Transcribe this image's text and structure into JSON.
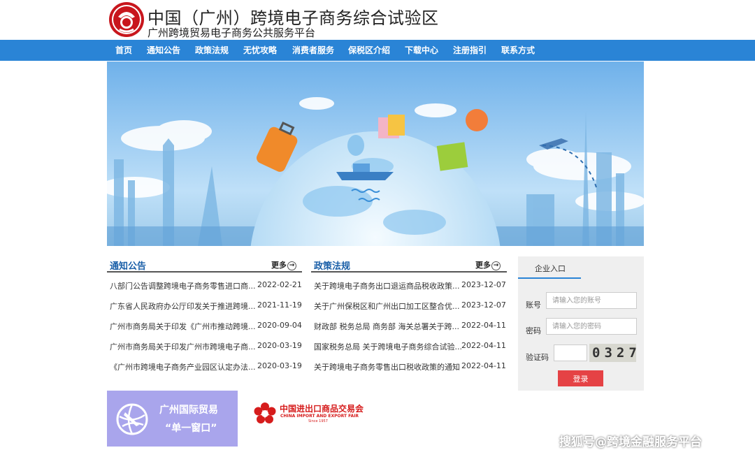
{
  "header": {
    "title": "中国（广州）跨境电子商务综合试验区",
    "subtitle": "广州跨境贸易电子商务公共服务平台"
  },
  "nav": {
    "items": [
      "首页",
      "通知公告",
      "政策法规",
      "无忧攻略",
      "消费者服务",
      "保税区介绍",
      "下载中心",
      "注册指引",
      "联系方式"
    ]
  },
  "notices": {
    "title": "通知公告",
    "more": "更多",
    "items": [
      {
        "title": "八部门公告调整跨境电子商务零售进口商...",
        "date": "2022-02-21"
      },
      {
        "title": "广东省人民政府办公厅印发关于推进跨境...",
        "date": "2021-11-19"
      },
      {
        "title": "广州市商务局关于印发《广州市推动跨境...",
        "date": "2020-09-04"
      },
      {
        "title": "广州市商务局关于印发广州市跨境电子商...",
        "date": "2020-03-19"
      },
      {
        "title": "《广州市跨境电子商务产业园区认定办法...",
        "date": "2020-03-19"
      }
    ]
  },
  "policies": {
    "title": "政策法规",
    "more": "更多",
    "items": [
      {
        "title": "关于跨境电子商务出口退运商品税收政策...",
        "date": "2023-12-07"
      },
      {
        "title": "关于广州保税区和广州出口加工区整合优...",
        "date": "2023-12-07"
      },
      {
        "title": "财政部 税务总局 商务部 海关总署关于跨...",
        "date": "2022-04-11"
      },
      {
        "title": "国家税务总局 关于跨境电子商务综合试验...",
        "date": "2022-04-11"
      },
      {
        "title": "关于跨境电子商务零售出口税收政策的通知",
        "date": "2022-04-11"
      }
    ]
  },
  "login": {
    "tab": "企业入口",
    "account_label": "账号",
    "account_placeholder": "请输入您的账号",
    "password_label": "密码",
    "password_placeholder": "请输入您的密码",
    "captcha_label": "验证码",
    "captcha_value": "0327",
    "submit": "登录"
  },
  "promo": {
    "single_window_line1": "广州国际贸易",
    "single_window_line2": "“单一窗口”",
    "fair_cn": "中国进出口商品交易会",
    "fair_en": "CHINA IMPORT AND EXPORT FAIR",
    "fair_since": "Since 1957"
  },
  "watermark": "搜狐号@跨境金融服务平台",
  "colors": {
    "nav": "#2a84d6",
    "heading": "#1a5fa8",
    "login_button": "#e54245",
    "single_window_bg": "#a9a5ec",
    "fair_red": "#d61c1c"
  }
}
